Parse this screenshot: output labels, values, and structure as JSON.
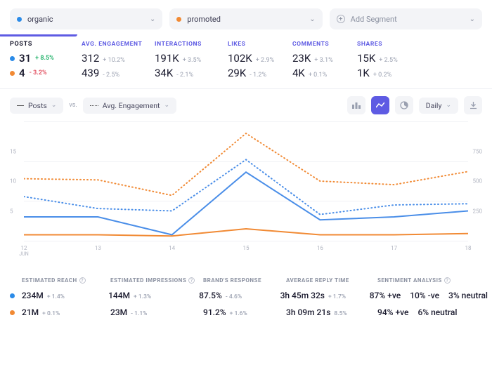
{
  "segments": {
    "a": {
      "label": "organic",
      "color": "#2b8be8"
    },
    "b": {
      "label": "promoted",
      "color": "#f18a34"
    },
    "add": "Add Segment"
  },
  "metrics": {
    "posts": {
      "header": "POSTS",
      "a_val": "31",
      "a_delta": "+ 8.5%",
      "b_val": "4",
      "b_delta": "- 3.2%"
    },
    "cols": [
      {
        "header": "AVG. ENGAGEMENT",
        "a_val": "312",
        "a_delta": "+ 10.2%",
        "b_val": "439",
        "b_delta": "- 2.5%"
      },
      {
        "header": "INTERACTIONS",
        "a_val": "191K",
        "a_delta": "+ 3.5%",
        "b_val": "34K",
        "b_delta": "- 2.1%"
      },
      {
        "header": "LIKES",
        "a_val": "102K",
        "a_delta": "+ 2.9%",
        "b_val": "29K",
        "b_delta": "- 1.2%"
      },
      {
        "header": "COMMENTS",
        "a_val": "23K",
        "a_delta": "+ 3.1%",
        "b_val": "4K",
        "b_delta": "+ 0.1%"
      },
      {
        "header": "SHARES",
        "a_val": "15K",
        "a_delta": "+ 2.5%",
        "b_val": "1K",
        "b_delta": "+ 0.2%"
      }
    ]
  },
  "chart_ctrl": {
    "left": "Posts",
    "vs": "vs.",
    "right": "Avg. Engagement",
    "period": "Daily"
  },
  "chart_data": {
    "type": "line",
    "x": [
      12,
      13,
      14,
      15,
      16,
      17,
      18
    ],
    "x_month": "JUN",
    "y_left_ticks": [
      5,
      10,
      15
    ],
    "y_right_ticks": [
      250,
      500,
      750
    ],
    "y_left_range": [
      0,
      20
    ],
    "y_right_range": [
      0,
      1000
    ],
    "series": [
      {
        "name": "organic posts",
        "axis": "left",
        "style": "solid",
        "color": "#4a8ee8",
        "values": [
          4,
          4,
          1,
          11.5,
          3.5,
          4,
          5
        ]
      },
      {
        "name": "organic engagement",
        "axis": "right",
        "style": "dashed",
        "color": "#4a8ee8",
        "values": [
          370,
          270,
          250,
          680,
          220,
          300,
          310
        ]
      },
      {
        "name": "promoted posts",
        "axis": "left",
        "style": "solid",
        "color": "#f18a34",
        "values": [
          1,
          1,
          0.8,
          2,
          1,
          1,
          1.2
        ]
      },
      {
        "name": "promoted engagement",
        "axis": "right",
        "style": "dashed",
        "color": "#f18a34",
        "values": [
          520,
          510,
          380,
          900,
          500,
          470,
          580
        ]
      }
    ]
  },
  "bottom": {
    "headers": [
      "ESTIMATED REACH",
      "ESTIMATED IMPRESSIONS",
      "BRAND'S RESPONSE",
      "AVERAGE REPLY TIME",
      "SENTIMENT ANALYSIS"
    ],
    "rows": [
      {
        "color": "blue",
        "reach": "234M",
        "reach_d": "+ 1.4%",
        "impr": "144M",
        "impr_d": "+ 1.3%",
        "resp": "87.5%",
        "resp_d": "- 4.6%",
        "reply": "3h 45m 32s",
        "reply_d": "+ 1.7%",
        "sent_pos": "87% +ve",
        "sent_neg": "10% -ve",
        "sent_neu": "3% neutral"
      },
      {
        "color": "orange",
        "reach": "21M",
        "reach_d": "+ 0.1%",
        "impr": "23M",
        "impr_d": "- 1.1%",
        "resp": "91.2%",
        "resp_d": "+ 1.6%",
        "reply": "3h 09m 21s",
        "reply_d": "8.5%",
        "sent_pos": "94% +ve",
        "sent_neg": "",
        "sent_neu": "6% neutral"
      }
    ]
  }
}
